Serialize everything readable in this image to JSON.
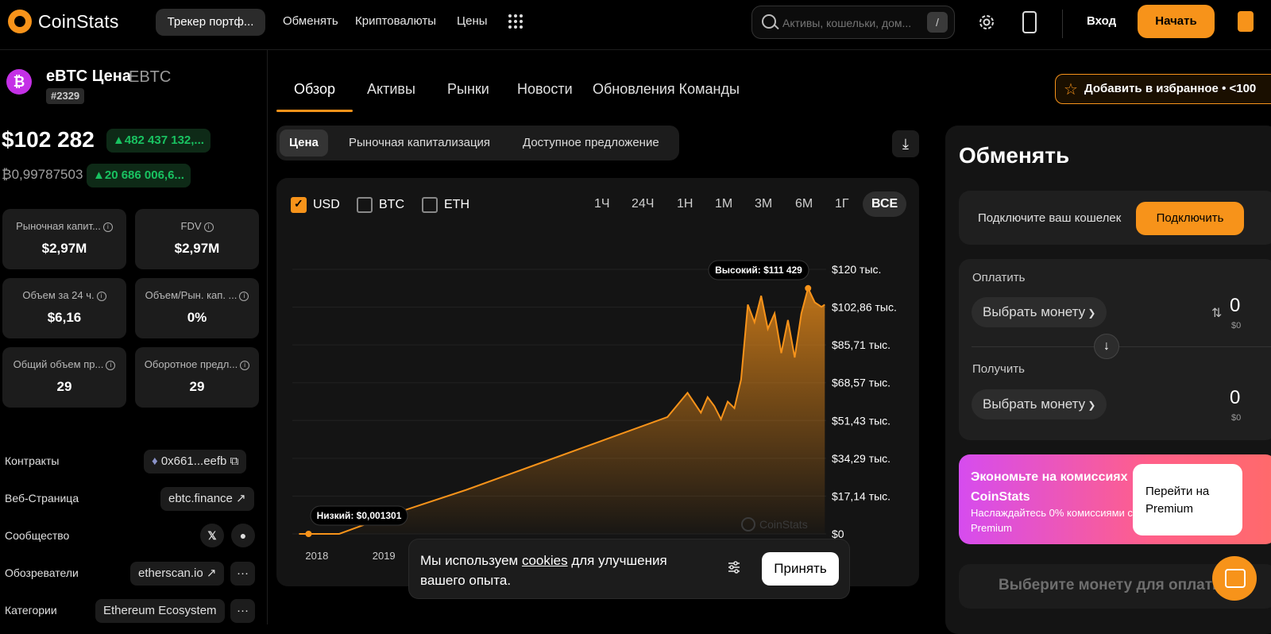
{
  "header": {
    "logo": "CoinStats",
    "tracker_pill": "Трекер портф...",
    "nav": [
      "Обменять",
      "Криптовалюты",
      "Цены"
    ],
    "search_placeholder": "Активы, кошельки, дом...",
    "search_shortcut": "/",
    "login": "Вход",
    "start": "Начать"
  },
  "coin": {
    "name": "eBTC Цена",
    "symbol": "EBTC",
    "rank": "#2329",
    "price": "$102 282",
    "change_usd": "▲482 437 132,...",
    "price_btc": "₿0,99787503",
    "change_btc": "▲20 686 006,6...",
    "stats": [
      {
        "label": "Рыночная капит...",
        "value": "$2,97M"
      },
      {
        "label": "FDV",
        "value": "$2,97M"
      },
      {
        "label": "Объем за 24 ч.",
        "value": "$6,16"
      },
      {
        "label": "Объем/Рын. кап. ...",
        "value": "0%"
      },
      {
        "label": "Общий объем пр...",
        "value": "29"
      },
      {
        "label": "Оборотное предл...",
        "value": "29"
      }
    ],
    "links": {
      "contracts_label": "Контракты",
      "contracts_value": "0x661...eefb",
      "website_label": "Веб-Страница",
      "website_value": "ebtc.finance",
      "community_label": "Сообщество",
      "explorers_label": "Обозреватели",
      "explorers_value": "etherscan.io",
      "more": "···",
      "categories_label": "Категории",
      "categories_value": "Ethereum Ecosystem"
    }
  },
  "tabs": [
    "Обзор",
    "Активы",
    "Рынки",
    "Новости",
    "Обновления Команды"
  ],
  "favorite": "Добавить в избранное • <100",
  "segments": [
    "Цена",
    "Рыночная капитализация",
    "Доступное предложение"
  ],
  "chart_controls": {
    "currencies": [
      {
        "label": "USD",
        "checked": true
      },
      {
        "label": "BTC",
        "checked": false
      },
      {
        "label": "ETH",
        "checked": false
      }
    ],
    "ranges": [
      "1Ч",
      "24Ч",
      "1Н",
      "1М",
      "3М",
      "6М",
      "1Г",
      "ВСЕ"
    ],
    "active_range": "ВСЕ"
  },
  "chart_data": {
    "type": "area",
    "x_ticks": [
      "2018",
      "2019"
    ],
    "y_ticks": [
      "$120 тыс.",
      "$102,86 тыс.",
      "$85,71 тыс.",
      "$68,57 тыс.",
      "$51,43 тыс.",
      "$34,29 тыс.",
      "$17,14 тыс.",
      "$0"
    ],
    "ylim": [
      0,
      120000
    ],
    "high_label": "Высокий: $111 429",
    "low_label": "Низкий: $0,001301",
    "watermark": "CoinStats",
    "color": "#f7931a",
    "series": [
      {
        "x": [
          2018.0,
          2018.3,
          2018.6,
          2019.5,
          2020.5,
          2021.5,
          2022.5,
          2023.5,
          2023.8,
          2024.0,
          2024.1,
          2024.2,
          2024.3,
          2024.4,
          2024.5,
          2024.6,
          2024.7,
          2024.8,
          2024.9,
          2025.0,
          2025.1,
          2025.2,
          2025.3,
          2025.4,
          2025.5,
          2025.6,
          2025.7,
          2025.8,
          2025.85
        ],
        "values": [
          0,
          0,
          0,
          10000,
          20000,
          31000,
          42000,
          53000,
          64000,
          55000,
          62000,
          58000,
          52000,
          60000,
          57000,
          70000,
          104000,
          96000,
          108000,
          93000,
          100000,
          82000,
          97000,
          80000,
          100000,
          111429,
          105000,
          103000,
          104000
        ]
      }
    ]
  },
  "swap": {
    "title": "Обменять",
    "connect_text": "Подключите ваш кошелек",
    "connect_btn": "Подключить",
    "pay_label": "Оплатить",
    "receive_label": "Получить",
    "select_coin": "Выбрать монету",
    "amount": "0",
    "amount_usd": "$0",
    "pay_button": "Выберите монету для оплаты"
  },
  "promo": {
    "title": "Экономьте на комиссиях CoinStats",
    "subtitle": "Наслаждайтесь 0% комиссиями с Premium",
    "button": "Перейти на Premium"
  },
  "cookie": {
    "text_before": "Мы используем ",
    "link": "cookies",
    "text_after": " для улучшения вашего опыта.",
    "accept": "Принять"
  }
}
